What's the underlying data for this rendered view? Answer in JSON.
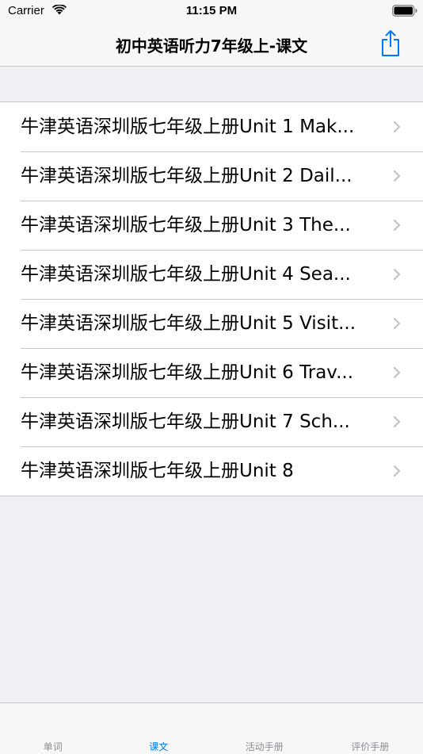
{
  "status_bar": {
    "carrier": "Carrier",
    "time": "11:15 PM"
  },
  "nav": {
    "title": "初中英语听力7年级上-课文",
    "share_icon": "share-icon",
    "accent_color": "#007aff"
  },
  "list": {
    "items": [
      {
        "label": "牛津英语深圳版七年级上册Unit 1 Mak..."
      },
      {
        "label": "牛津英语深圳版七年级上册Unit 2 Dail..."
      },
      {
        "label": "牛津英语深圳版七年级上册Unit 3 The..."
      },
      {
        "label": "牛津英语深圳版七年级上册Unit 4 Sea..."
      },
      {
        "label": "牛津英语深圳版七年级上册Unit 5 Visit..."
      },
      {
        "label": "牛津英语深圳版七年级上册Unit 6 Trav..."
      },
      {
        "label": "牛津英语深圳版七年级上册Unit 7 Sch..."
      },
      {
        "label": "牛津英语深圳版七年级上册Unit 8"
      }
    ]
  },
  "tab_bar": {
    "tabs": [
      {
        "label": "单词",
        "active": false
      },
      {
        "label": "课文",
        "active": true
      },
      {
        "label": "活动手册",
        "active": false
      },
      {
        "label": "评价手册",
        "active": false
      }
    ]
  }
}
